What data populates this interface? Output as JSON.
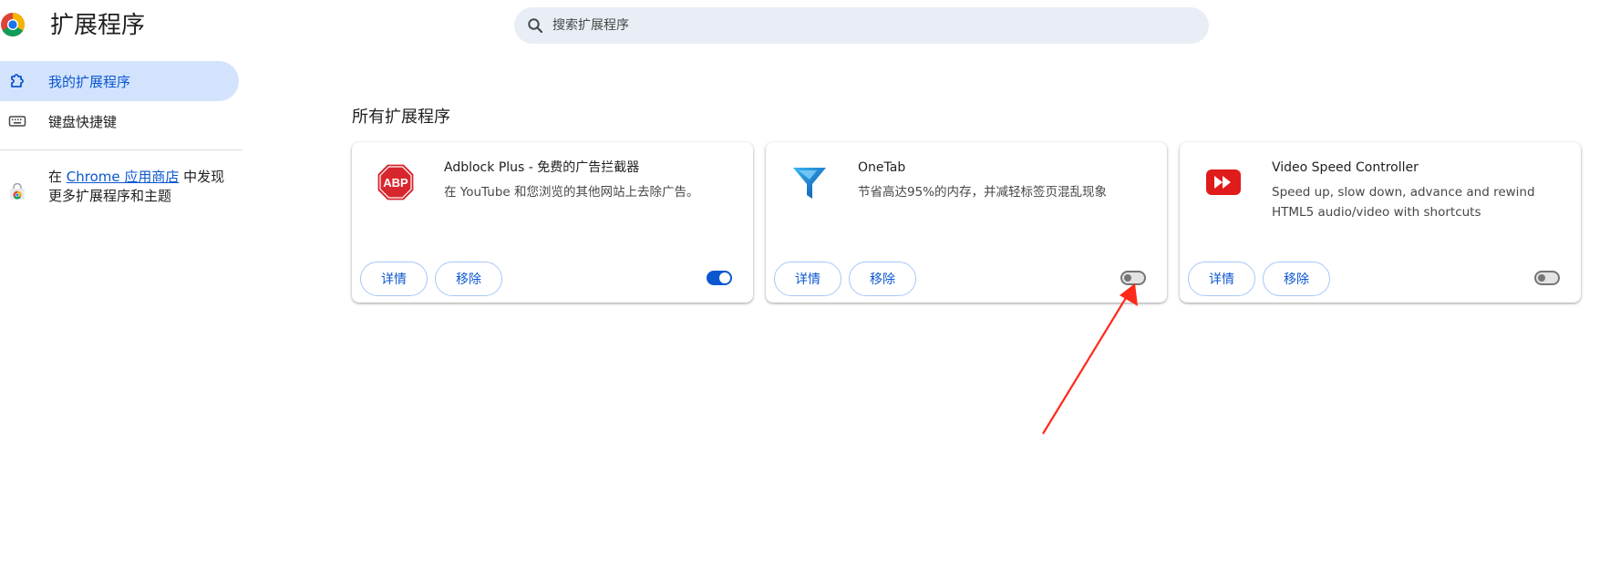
{
  "header": {
    "title": "扩展程序",
    "search_placeholder": "搜索扩展程序"
  },
  "sidebar": {
    "items": [
      {
        "label": "我的扩展程序",
        "icon": "extension-icon"
      },
      {
        "label": "键盘快捷键",
        "icon": "keyboard-icon"
      }
    ],
    "store_prefix": "在 ",
    "store_link": "Chrome 应用商店",
    "store_suffix": " 中发现更多扩展程序和主题"
  },
  "main": {
    "section_title": "所有扩展程序",
    "extensions": [
      {
        "name": "Adblock Plus - 免费的广告拦截器",
        "description": "在 YouTube 和您浏览的其他网站上去除广告。",
        "icon": "abp-icon",
        "icon_text": "ABP",
        "details_label": "详情",
        "remove_label": "移除",
        "enabled": true
      },
      {
        "name": "OneTab",
        "description": "节省高达95%的内存，并减轻标签页混乱现象",
        "icon": "onetab-funnel-icon",
        "details_label": "详情",
        "remove_label": "移除",
        "enabled": false
      },
      {
        "name": "Video Speed Controller",
        "description": "Speed up, slow down, advance and rewind HTML5 audio/video with shortcuts",
        "icon": "video-speed-icon",
        "details_label": "详情",
        "remove_label": "移除",
        "enabled": false
      }
    ]
  },
  "colors": {
    "accent": "#0b57d0",
    "active_nav_bg": "#d3e3fd",
    "search_bg": "#e9eef6",
    "annotation_arrow": "#ff2a1a"
  }
}
